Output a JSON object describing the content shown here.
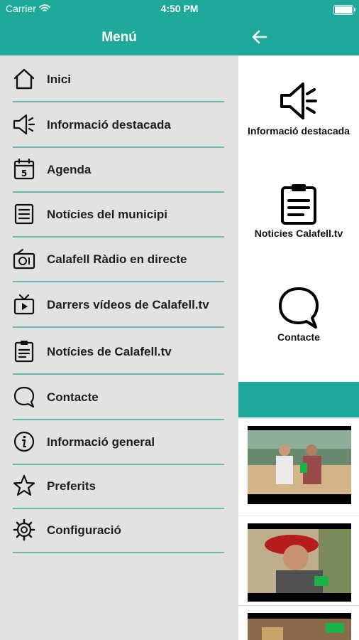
{
  "status_bar": {
    "carrier": "Carrier",
    "time": "4:50 PM"
  },
  "drawer": {
    "title": "Menú",
    "items": [
      {
        "label": "Inici",
        "icon": "home-icon"
      },
      {
        "label": "Informació destacada",
        "icon": "megaphone-icon"
      },
      {
        "label": "Agenda",
        "icon": "calendar-icon"
      },
      {
        "label": "Notícies del municipi",
        "icon": "news-icon"
      },
      {
        "label": "Calafell Ràdio en directe",
        "icon": "radio-icon"
      },
      {
        "label": "Darrers vídeos de Calafell.tv",
        "icon": "tv-icon"
      },
      {
        "label": "Notícies de Calafell.tv",
        "icon": "clipboard-icon"
      },
      {
        "label": "Contacte",
        "icon": "chat-bubble-icon"
      },
      {
        "label": "Informació general",
        "icon": "info-icon"
      },
      {
        "label": "Preferits",
        "icon": "star-icon"
      },
      {
        "label": "Configuració",
        "icon": "gear-icon"
      }
    ]
  },
  "background_screen": {
    "tiles": [
      {
        "label": "Informació destacada",
        "icon": "megaphone-icon"
      },
      {
        "label": "Noticies Calafell.tv",
        "icon": "clipboard-icon"
      },
      {
        "label": "Contacte",
        "icon": "chat-bubble-icon"
      }
    ],
    "videos": [
      {
        "name": "video-thumbnail-1"
      },
      {
        "name": "video-thumbnail-2"
      },
      {
        "name": "video-thumbnail-3"
      }
    ]
  },
  "colors": {
    "accent": "#1fa99a",
    "drawer_bg": "#e2e2e2",
    "separator": "#6fb7a9"
  }
}
